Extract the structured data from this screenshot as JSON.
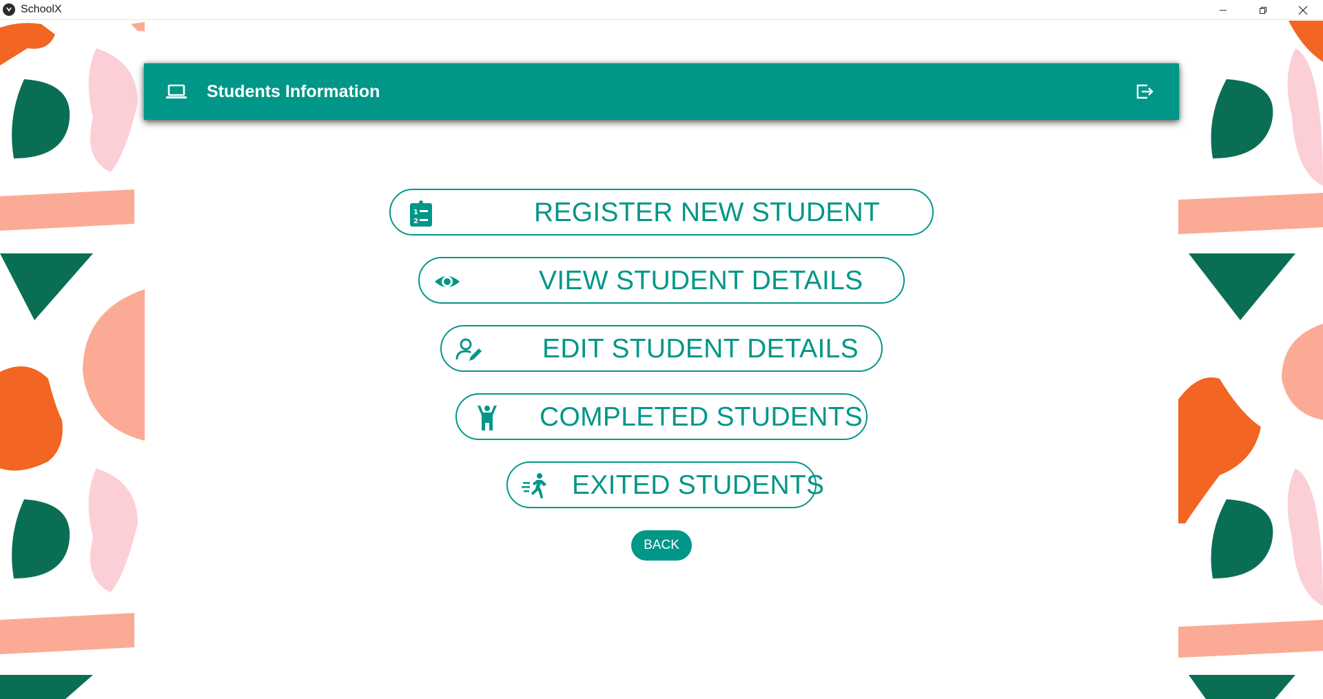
{
  "window": {
    "title": "SchoolX",
    "controls": [
      "minimize-icon",
      "restore-icon",
      "close-icon"
    ]
  },
  "header": {
    "title": "Students Information",
    "left_icon": "laptop-icon",
    "right_icon": "logout-icon"
  },
  "menu": [
    {
      "label": "REGISTER NEW STUDENT",
      "icon": "clipboard-list-icon"
    },
    {
      "label": "VIEW STUDENT DETAILS",
      "icon": "eye-icon"
    },
    {
      "label": "EDIT STUDENT DETAILS",
      "icon": "user-edit-icon"
    },
    {
      "label": "COMPLETED STUDENTS",
      "icon": "person-raised-arms-icon"
    },
    {
      "label": "EXITED STUDENTS",
      "icon": "running-person-icon"
    }
  ],
  "back_label": "BACK",
  "colors": {
    "primary": "#009688",
    "deco_orange": "#f26522",
    "deco_green": "#0a6e55",
    "deco_pink": "#fccfd7",
    "deco_salmon": "#fbab95",
    "deco_gold": "#e8930a"
  }
}
